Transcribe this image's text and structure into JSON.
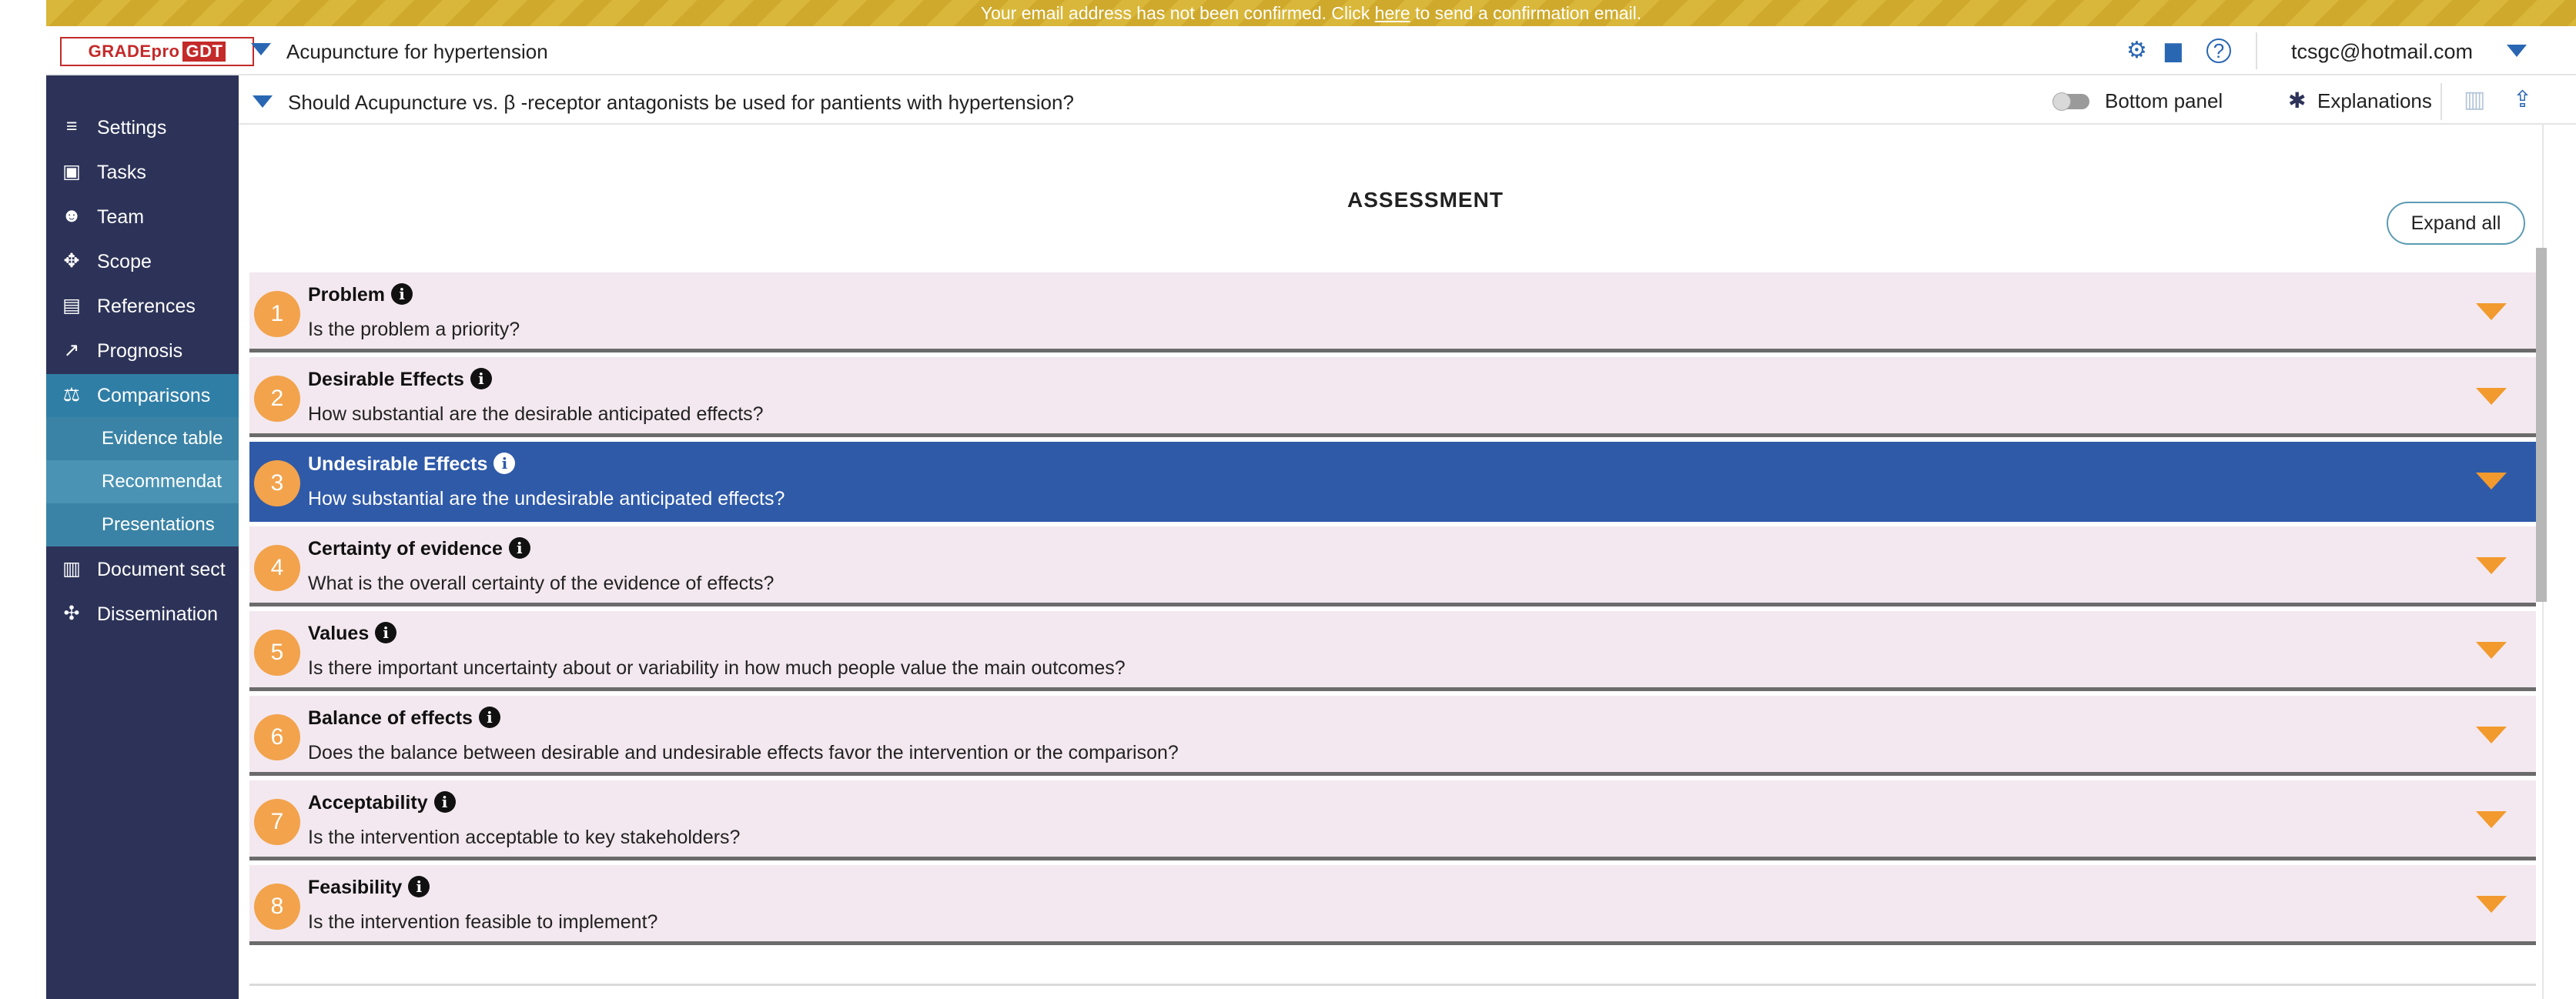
{
  "banner": {
    "text_before": "Your email address has not been confirmed. Click ",
    "link": "here",
    "text_after": " to send a confirmation email."
  },
  "header": {
    "logo_main": "GRADEpro",
    "logo_suffix": "GDT",
    "project_title": "Acupuncture for hypertension",
    "user_email": "tcsgc@hotmail.com",
    "icons": [
      "gears-icon",
      "chat-icon",
      "help-icon"
    ]
  },
  "sidebar": {
    "items": [
      {
        "label": "Settings",
        "icon": "sliders-icon"
      },
      {
        "label": "Tasks",
        "icon": "tasks-icon"
      },
      {
        "label": "Team",
        "icon": "team-icon"
      },
      {
        "label": "Scope",
        "icon": "scope-icon"
      },
      {
        "label": "References",
        "icon": "references-icon"
      },
      {
        "label": "Prognosis",
        "icon": "prognosis-icon"
      },
      {
        "label": "Comparisons",
        "icon": "scales-icon"
      },
      {
        "label": "Document sect",
        "icon": "document-icon"
      },
      {
        "label": "Dissemination",
        "icon": "dissemination-icon"
      }
    ],
    "subitems": [
      {
        "label": "Evidence table"
      },
      {
        "label": "Recommendat"
      },
      {
        "label": "Presentations"
      }
    ]
  },
  "question_bar": {
    "question": "Should Acupuncture vs. β -receptor antagonists be used for pantients with hypertension?",
    "bottom_panel_label": "Bottom panel",
    "explanations_label": "Explanations"
  },
  "main": {
    "title": "ASSESSMENT",
    "expand_all_label": "Expand all",
    "sections": [
      {
        "num": "1",
        "title": "Problem",
        "question": "Is the problem a priority?"
      },
      {
        "num": "2",
        "title": "Desirable Effects",
        "question": "How substantial are the desirable anticipated effects?"
      },
      {
        "num": "3",
        "title": "Undesirable Effects",
        "question": "How substantial are the undesirable anticipated effects?"
      },
      {
        "num": "4",
        "title": "Certainty of evidence",
        "question": "What is the overall certainty of the evidence of effects?"
      },
      {
        "num": "5",
        "title": "Values",
        "question": "Is there important uncertainty about or variability in how much people value the main outcomes?"
      },
      {
        "num": "6",
        "title": "Balance of effects",
        "question": "Does the balance between desirable and undesirable effects favor the intervention or the comparison?"
      },
      {
        "num": "7",
        "title": "Acceptability",
        "question": "Is the intervention acceptable to key stakeholders?"
      },
      {
        "num": "8",
        "title": "Feasibility",
        "question": "Is the intervention feasible to implement?"
      }
    ]
  },
  "colors": {
    "sidebar_bg": "#2d3358",
    "sidebar_active": "#2f7ea6",
    "selected_row": "#2f5aa8",
    "row_bg": "#f3e8ef",
    "number_badge": "#f2a34c",
    "toggle_arrow": "#f29a2e",
    "banner": "#d9b73a"
  }
}
